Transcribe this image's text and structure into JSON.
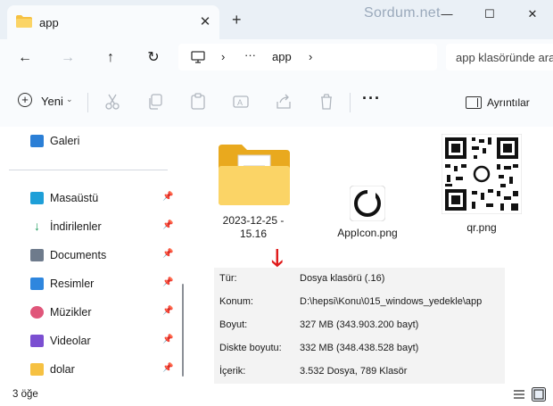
{
  "titlebar": {
    "tab_title": "app",
    "close_tab": "✕",
    "new_tab": "+",
    "watermark": "Sordum.net",
    "minimize": "—",
    "maximize": "☐",
    "close": "✕"
  },
  "navbar": {
    "back": "←",
    "forward": "→",
    "up": "↑",
    "refresh": "↻",
    "sep1": "›",
    "ellipsis": "···",
    "current": "app",
    "sep2": "›",
    "search_placeholder": "app klasöründe ara"
  },
  "toolbar": {
    "new_label": "Yeni",
    "new_chevron": "⌄",
    "more": "···",
    "details_label": "Ayrıntılar"
  },
  "sidebar": {
    "items": [
      {
        "label": "Galeri",
        "icon": "gallery-icon"
      },
      {
        "label": "Masaüstü",
        "icon": "desktop-icon",
        "pinned": true
      },
      {
        "label": "İndirilenler",
        "icon": "download-icon",
        "pinned": true
      },
      {
        "label": "Documents",
        "icon": "documents-icon",
        "pinned": true
      },
      {
        "label": "Resimler",
        "icon": "pictures-icon",
        "pinned": true
      },
      {
        "label": "Müzikler",
        "icon": "music-icon",
        "pinned": true
      },
      {
        "label": "Videolar",
        "icon": "videos-icon",
        "pinned": true
      },
      {
        "label": "dolar",
        "icon": "folder-icon",
        "pinned": true
      }
    ],
    "pin_glyph": "📌"
  },
  "files": [
    {
      "label_line1": "2023-12-25 -",
      "label_line2": "15.16",
      "type": "folder"
    },
    {
      "label_line1": "AppIcon.png",
      "type": "image"
    },
    {
      "label_line1": "qr.png",
      "type": "qr"
    }
  ],
  "arrow": "🡓",
  "details": {
    "rows": [
      {
        "key": "Tür:",
        "value": "Dosya klasörü (.16)"
      },
      {
        "key": "Konum:",
        "value": "D:\\hepsi\\Konu\\015_windows_yedekle\\app"
      },
      {
        "key": "Boyut:",
        "value": "327 MB (343.903.200 bayt)"
      },
      {
        "key": "Diskte boyutu:",
        "value": "332 MB (348.438.528 bayt)"
      },
      {
        "key": "İçerik:",
        "value": "3.532 Dosya, 789 Klasör"
      }
    ]
  },
  "status": {
    "count": "3 öğe"
  },
  "colors": {
    "accent": "#0067c0",
    "folder_yellow": "#f6c142",
    "arrow_red": "#e01b1b"
  }
}
